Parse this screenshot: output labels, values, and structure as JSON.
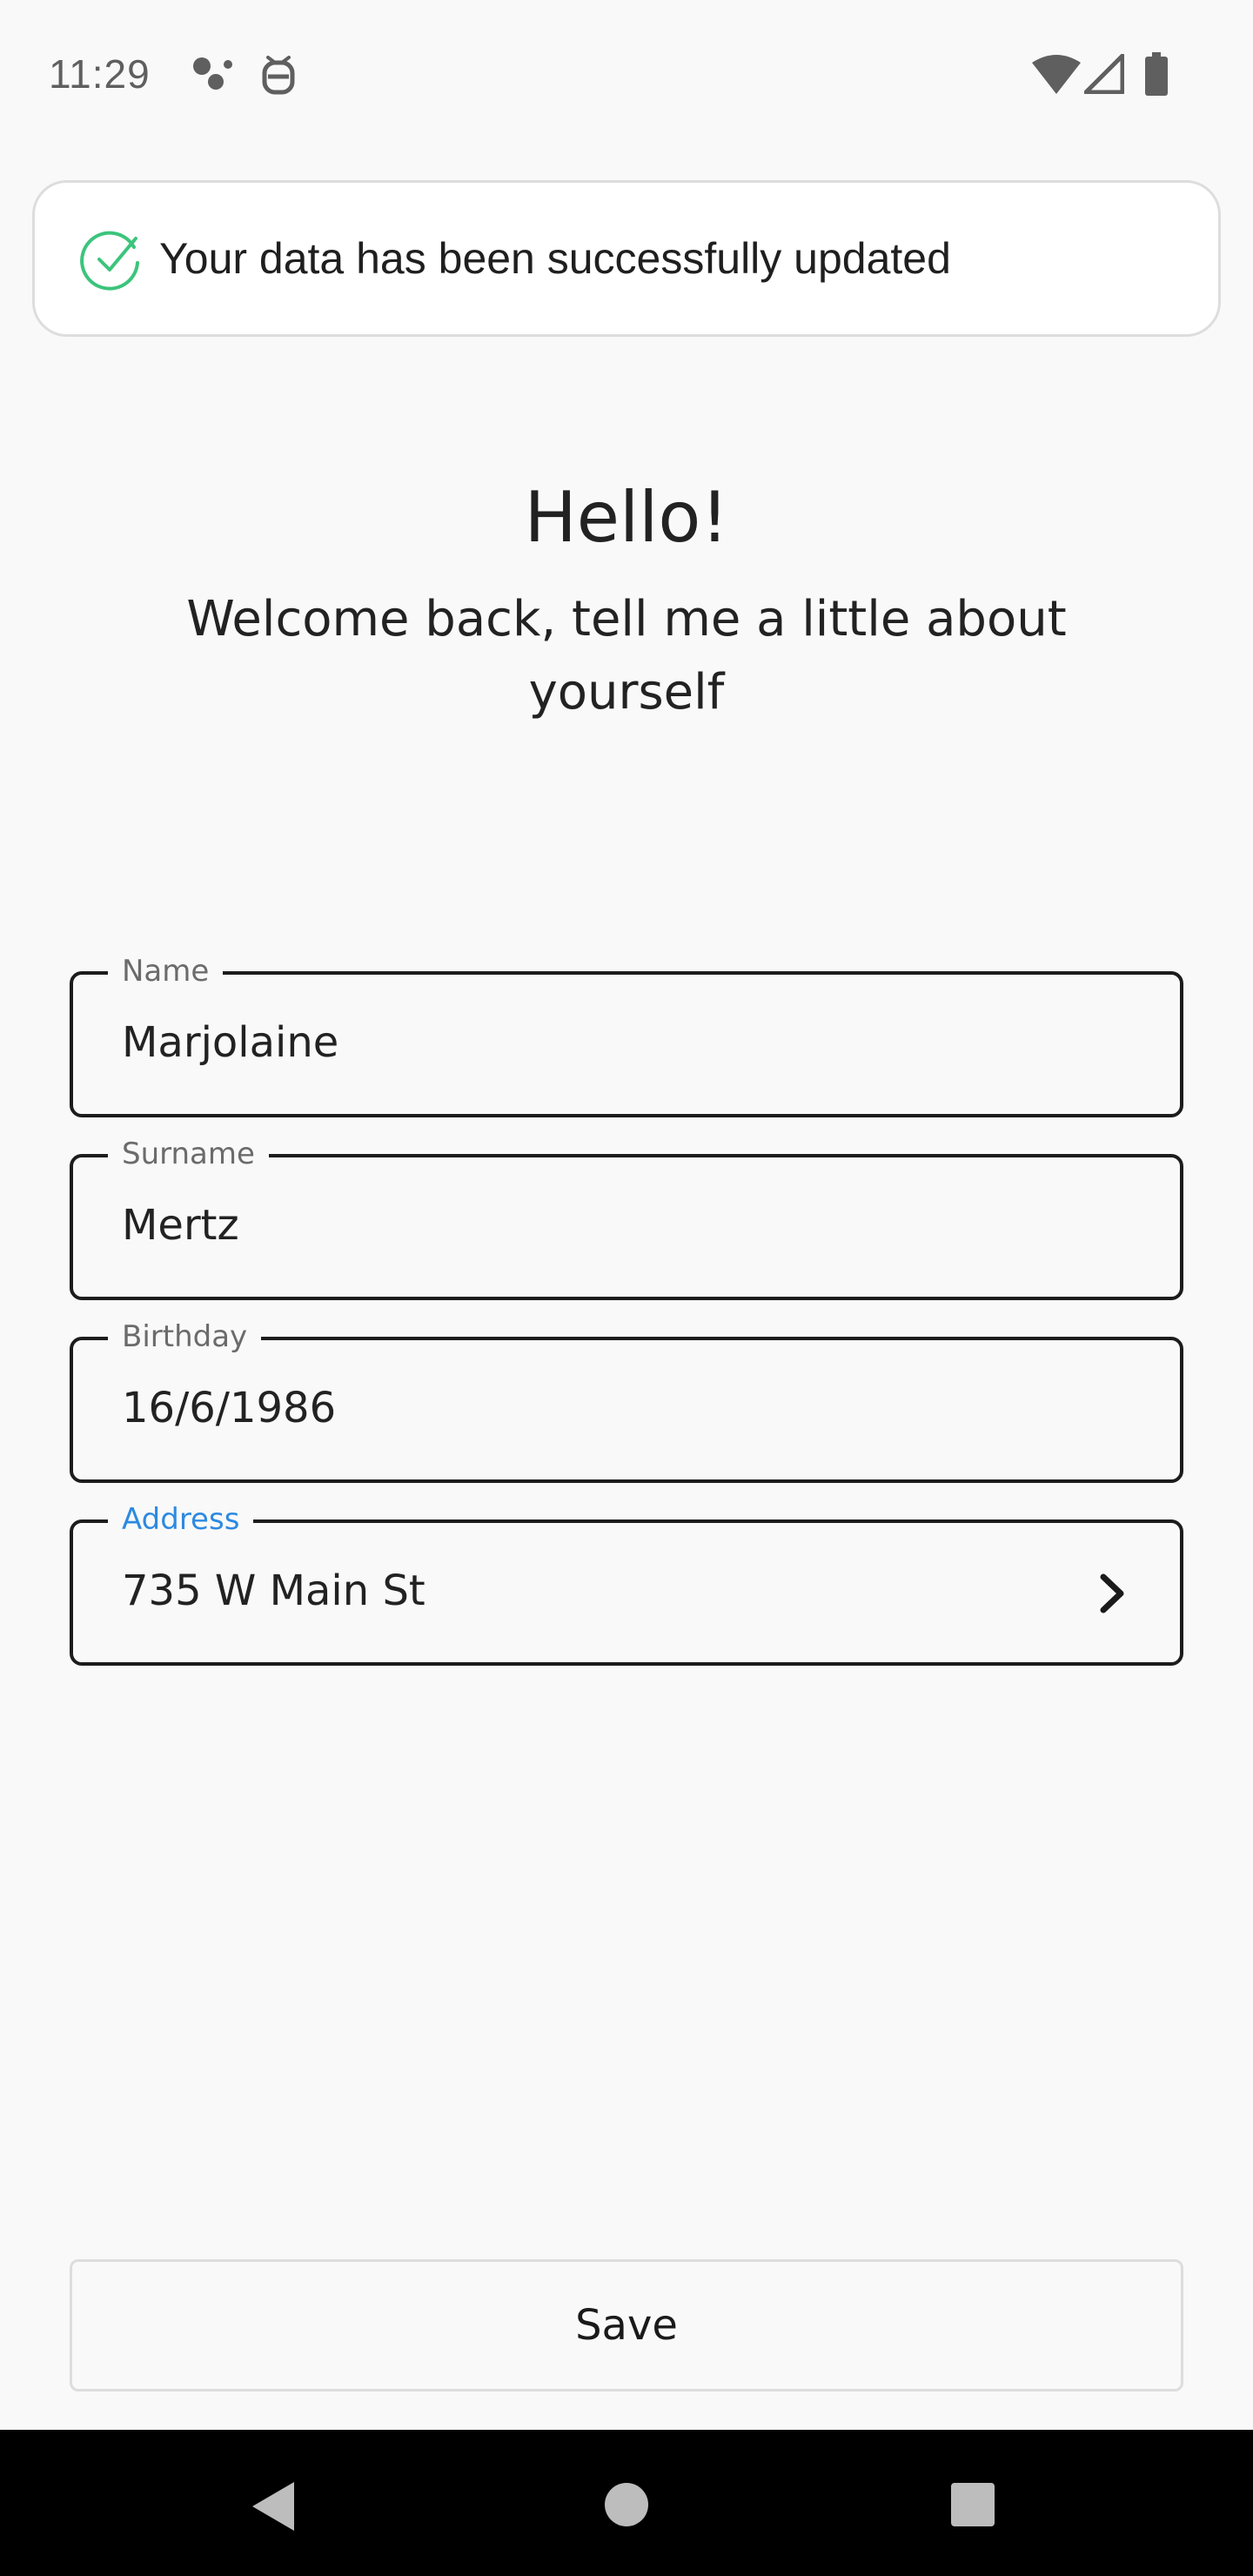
{
  "status_bar": {
    "time": "11:29",
    "left_icons": [
      "assistant-dots-icon",
      "robot-face-icon"
    ],
    "right_icons": [
      "wifi-icon",
      "cellular-signal-icon",
      "battery-icon"
    ]
  },
  "toast": {
    "icon": "check-circle-icon",
    "message": "Your data has been successfully updated",
    "accent_color": "#3cc47c"
  },
  "header": {
    "title": "Hello!",
    "subtitle": "Welcome back, tell me a little about yourself"
  },
  "form": {
    "fields": [
      {
        "label": "Name",
        "value": "Marjolaine",
        "focused": false
      },
      {
        "label": "Surname",
        "value": "Mertz",
        "focused": false
      },
      {
        "label": "Birthday",
        "value": "16/6/1986",
        "focused": false
      },
      {
        "label": "Address",
        "value": "735 W Main St",
        "focused": true,
        "trailing_icon": "chevron-right-icon"
      }
    ],
    "focus_color": "#2d8ae0"
  },
  "actions": {
    "save_label": "Save"
  },
  "nav_bar": {
    "buttons": [
      "back-triangle-icon",
      "home-circle-icon",
      "recents-square-icon"
    ]
  }
}
